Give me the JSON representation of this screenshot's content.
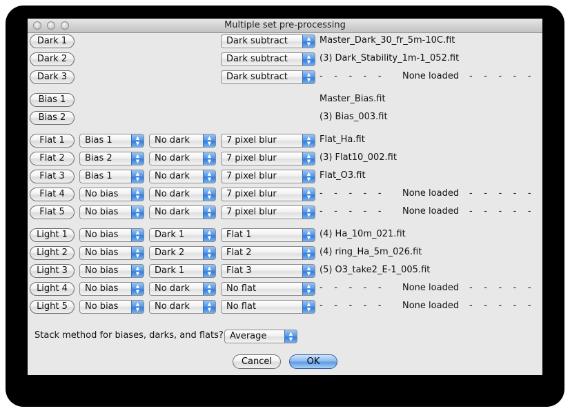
{
  "window": {
    "title": "Multiple set pre-processing"
  },
  "darks": [
    {
      "label": "Dark 1",
      "method": "Dark subtract",
      "file": "Master_Dark_30_fr_5m-10C.fit"
    },
    {
      "label": "Dark 2",
      "method": "Dark subtract",
      "file": "(3) Dark_Stability_1m-1_052.fit"
    },
    {
      "label": "Dark 3",
      "method": "Dark subtract",
      "file": "None loaded"
    }
  ],
  "biases": [
    {
      "label": "Bias 1",
      "file": "Master_Bias.fit"
    },
    {
      "label": "Bias 2",
      "file": "(3) Bias_003.fit"
    }
  ],
  "flats": [
    {
      "label": "Flat 1",
      "bias": "Bias 1",
      "dark": "No dark",
      "blur": "7 pixel blur",
      "file": "Flat_Ha.fit"
    },
    {
      "label": "Flat 2",
      "bias": "Bias 2",
      "dark": "No dark",
      "blur": "7 pixel blur",
      "file": "(3) Flat10_002.fit"
    },
    {
      "label": "Flat 3",
      "bias": "Bias 1",
      "dark": "No dark",
      "blur": "7 pixel blur",
      "file": "Flat_O3.fit"
    },
    {
      "label": "Flat 4",
      "bias": "No bias",
      "dark": "No dark",
      "blur": "7 pixel blur",
      "file": "None loaded"
    },
    {
      "label": "Flat 5",
      "bias": "No bias",
      "dark": "No dark",
      "blur": "7 pixel blur",
      "file": "None loaded"
    }
  ],
  "lights": [
    {
      "label": "Light 1",
      "bias": "No bias",
      "dark": "Dark 1",
      "flat": "Flat 1",
      "file": "(4) Ha_10m_021.fit"
    },
    {
      "label": "Light 2",
      "bias": "No bias",
      "dark": "Dark 2",
      "flat": "Flat 2",
      "file": "(4) ring_Ha_5m_026.fit"
    },
    {
      "label": "Light 3",
      "bias": "No bias",
      "dark": "Dark 1",
      "flat": "Flat 3",
      "file": "(5) O3_take2_E-1_005.fit"
    },
    {
      "label": "Light 4",
      "bias": "No bias",
      "dark": "No dark",
      "flat": "No flat",
      "file": "None loaded"
    },
    {
      "label": "Light 5",
      "bias": "No bias",
      "dark": "No dark",
      "flat": "No flat",
      "file": "None loaded"
    }
  ],
  "stack": {
    "label": "Stack method for biases, darks, and flats?",
    "value": "Average"
  },
  "buttons": {
    "cancel": "Cancel",
    "ok": "OK"
  },
  "dash_text": "-    -    -    -    -",
  "colors": {
    "accent": "#4f93e6",
    "window_bg": "#e8e8e8"
  }
}
